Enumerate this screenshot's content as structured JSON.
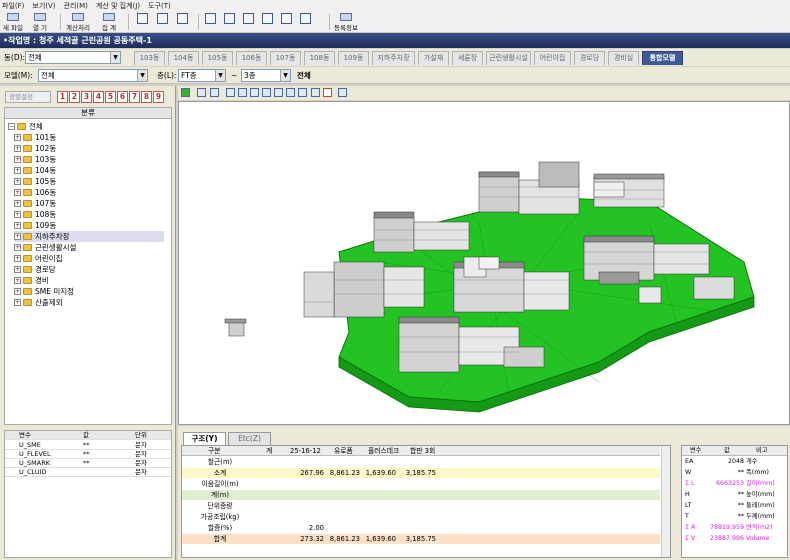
{
  "menu": [
    "파일(F)",
    "보기(V)",
    "관리(M)",
    "계산 및 집계(J)",
    "도구(T)"
  ],
  "toolbar": {
    "new_file": "새 파일",
    "open": "열 기",
    "calc_process": "계산처리",
    "total": "집 계",
    "register_info": "등록정보"
  },
  "title": "•작업명 : 청주 세적골 근린공원 공동주택-1",
  "dong_label": "동(D):",
  "dong_value": "전체",
  "tabs": [
    "103동",
    "104동",
    "105동",
    "106동",
    "107동",
    "108동",
    "109동",
    "지하주차장",
    "가설재",
    "세륜장",
    "근린생활시설",
    "어린이집",
    "경로당",
    "경비실",
    "통합모델"
  ],
  "model_label": "모델(M):",
  "model_value": "전체",
  "floor_label": "층(L):",
  "floor_from": "FT층",
  "floor_tilde": "~",
  "floor_to": "3층",
  "floor_all": "전체",
  "left_tools": {
    "sort_btn": "정렬설정",
    "numbers": [
      "1",
      "2",
      "3",
      "4",
      "5",
      "6",
      "7",
      "8",
      "9"
    ]
  },
  "tree": {
    "header": "분류",
    "root": "전체",
    "items": [
      "101동",
      "102동",
      "103동",
      "104동",
      "105동",
      "106동",
      "107동",
      "108동",
      "109동",
      "지하주차장",
      "근린생활시설",
      "어린이집",
      "경로당",
      "경비",
      "SME 미지정",
      "산출제외"
    ]
  },
  "vars": {
    "headers": [
      "변수",
      "값",
      "단위"
    ],
    "rows": [
      {
        "name": "U_SME",
        "val": "**",
        "unit": "문자"
      },
      {
        "name": "U_FLEVEL",
        "val": "**",
        "unit": "문자"
      },
      {
        "name": "U_SMARK",
        "val": "**",
        "unit": "문자"
      },
      {
        "name": "U_CLUID",
        "val": "",
        "unit": "문자"
      }
    ]
  },
  "bottom_tabs": [
    "구조(Y)",
    "Etc(Z)"
  ],
  "calc": {
    "headers": [
      "구분",
      "계",
      "25-16-12",
      "유로폼",
      "플러스데크",
      "합판 3회"
    ],
    "rows": [
      {
        "label": "철근(m)",
        "v": [
          "",
          "",
          "",
          "",
          ""
        ]
      },
      {
        "label": "소계",
        "v": [
          "",
          "267.96",
          "8,861.23",
          "1,639.60",
          "3,185.75"
        ]
      },
      {
        "label": "이음길이(m)",
        "v": [
          "",
          "",
          "",
          "",
          ""
        ]
      },
      {
        "label": "계(m)",
        "v": [
          "",
          "",
          "",
          "",
          ""
        ]
      },
      {
        "label": "단위중량",
        "v": [
          "",
          "",
          "",
          "",
          ""
        ]
      },
      {
        "label": "가공조립(kg)",
        "v": [
          "",
          "",
          "",
          "",
          ""
        ]
      },
      {
        "label": "할증(%)",
        "v": [
          "",
          "2.00",
          "",
          "",
          ""
        ]
      },
      {
        "label": "합계",
        "v": [
          "",
          "273.32",
          "8,861.23",
          "1,639.60",
          "3,185.75"
        ]
      }
    ]
  },
  "right_table": {
    "headers": [
      "변수",
      "값",
      "비고"
    ],
    "rows": [
      {
        "name": "EA",
        "val": "2048",
        "note": "개수",
        "pink": false
      },
      {
        "name": "W",
        "val": "**",
        "note": "폭(mm)",
        "pink": false
      },
      {
        "name": "Σ L",
        "val": "6663253",
        "note": "길이(mm)",
        "pink": true
      },
      {
        "name": "H",
        "val": "**",
        "note": "높이(mm)",
        "pink": false
      },
      {
        "name": "LT",
        "val": "**",
        "note": "둘레(mm)",
        "pink": false
      },
      {
        "name": "T",
        "val": "**",
        "note": "두께(mm)",
        "pink": false
      },
      {
        "name": "Σ A",
        "val": "78819.959",
        "note": "면적(m2)",
        "pink": true
      },
      {
        "name": "Σ V",
        "val": "23887.996",
        "note": "Volume",
        "pink": true
      }
    ]
  },
  "colors": {
    "title_bg": "#27386b",
    "active_tab": "#3d5a96",
    "green_ground": "#22c322",
    "highlight_row": "#fdf8c8",
    "sum_row": "#fde0c8",
    "green_row": "#dff0d0",
    "pink_text": "#e020e0"
  }
}
